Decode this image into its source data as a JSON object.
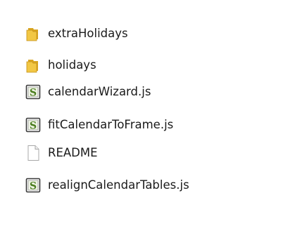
{
  "files": [
    {
      "name": "extraHolidays",
      "type": "folder",
      "icon": "folder-icon"
    },
    {
      "name": "holidays",
      "type": "folder",
      "icon": "folder-icon"
    },
    {
      "name": "calendarWizard.js",
      "type": "script",
      "icon": "script-file-icon"
    },
    {
      "name": "fitCalendarToFrame.js",
      "type": "script",
      "icon": "script-file-icon"
    },
    {
      "name": "README",
      "type": "file",
      "icon": "blank-file-icon"
    },
    {
      "name": "realignCalendarTables.js",
      "type": "script",
      "icon": "script-file-icon"
    }
  ],
  "colors": {
    "folder_front": "#f2c744",
    "folder_back": "#d9a520",
    "script_border": "#3a3a3a",
    "script_glyph": "#4a7d1e",
    "file_border": "#a8a8a8"
  }
}
